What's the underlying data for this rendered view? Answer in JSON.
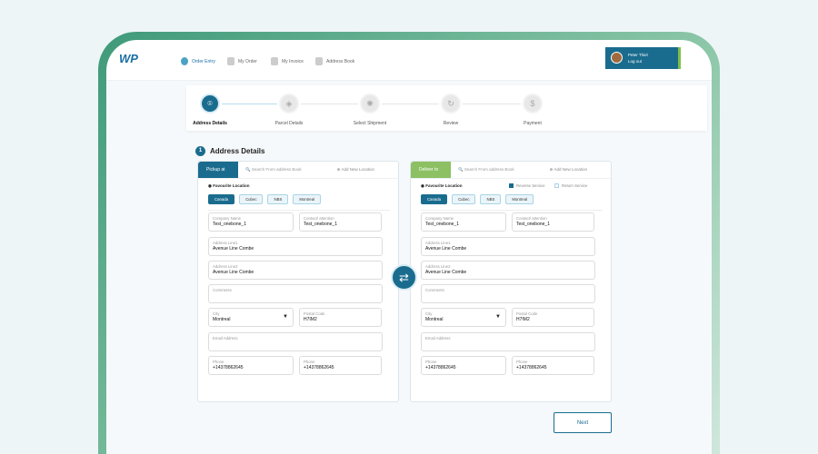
{
  "header": {
    "logo": "WP",
    "nav": [
      {
        "label": "Order Entry",
        "active": true
      },
      {
        "label": "My Order"
      },
      {
        "label": "My Invoice"
      },
      {
        "label": "Address Book"
      }
    ],
    "user": {
      "name": "Peter Thiel",
      "logout": "Log out"
    }
  },
  "stepper": {
    "steps": [
      {
        "label": "Address Details",
        "icon": "location-icon"
      },
      {
        "label": "Parcel Details",
        "icon": "parcel-icon"
      },
      {
        "label": "Select Shipment",
        "icon": "shipment-icon"
      },
      {
        "label": "Review",
        "icon": "review-icon"
      },
      {
        "label": "Payment",
        "icon": "payment-icon"
      }
    ]
  },
  "section": {
    "number": "1",
    "title": "Address Details"
  },
  "panels": [
    {
      "tab": "Pickup at",
      "tab_color": "#1a6c8e",
      "search_placeholder": "Search From address Book",
      "add_location": "Add New Location",
      "favourite": "Favourite Location",
      "chips": [
        "Canada",
        "Cubec",
        "NBS",
        "Montreal"
      ],
      "fields": {
        "company_label": "Company Name",
        "company": "Test_onebone_1",
        "contact_label": "Contact/ attention",
        "contact": "Test_onebone_1",
        "addr1_label": "Address Line1",
        "addr1": "Avenue Line Combe",
        "addr2_label": "Address Line2",
        "addr2": "Avenue Line Combe",
        "comments_label": "Comments",
        "city_label": "City",
        "city": "Montreal",
        "postal_label": "Postal Code",
        "postal": "H7IM2",
        "email_label": "Email Address",
        "phone_label": "Phone",
        "phone": "+14378862645",
        "phone2_label": "Phone",
        "phone2": "+14378862645"
      }
    },
    {
      "tab": "Deliver to",
      "tab_color": "#8cc063",
      "search_placeholder": "Search From address Book",
      "add_location": "Add New Location",
      "favourite": "Favourite Location",
      "chips": [
        "Canada",
        "Cubec",
        "NBS",
        "Montreal"
      ],
      "reverse": "Reverse Service",
      "return": "Return Service",
      "fields": {
        "company_label": "Company Name",
        "company": "Test_onebone_1",
        "contact_label": "Contact/ attention",
        "contact": "Test_onebone_1",
        "addr1_label": "Address Line1",
        "addr1": "Avenue Line Combe",
        "addr2_label": "Address Line2",
        "addr2": "Avenue Line Combe",
        "comments_label": "Comments",
        "city_label": "City",
        "city": "Montreal",
        "postal_label": "Postal Code",
        "postal": "H7IM2",
        "email_label": "Email Address",
        "phone_label": "Phone",
        "phone": "+14378862645",
        "phone2_label": "Phone",
        "phone2": "+14378862645"
      }
    }
  ],
  "swap_icon": "⇄",
  "next_label": "Next"
}
